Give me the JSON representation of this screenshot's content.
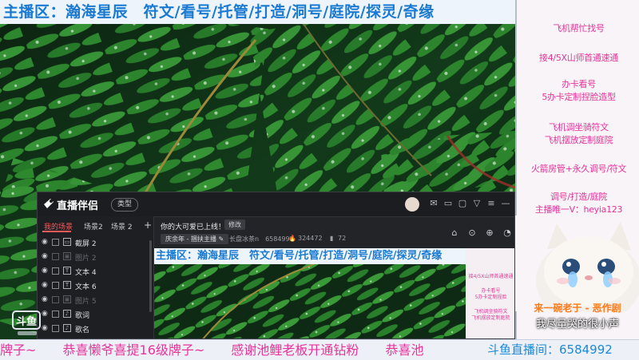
{
  "stream": {
    "top_banner": "主播区：瀚海星辰　符文/看号/托管/打造/洞号/庭院/探灵/奇缘",
    "right_panel": {
      "lines": [
        "飞机帮忙找号",
        "接4/5X山师首通速通",
        "办卡看号",
        "5办卡定制捏脸造型",
        "飞机调坐骑符文",
        "飞机摆放定制庭院",
        "火箭房管+永久调号/符文",
        "调号/打造/庭院",
        "主播唯一V：heyia123"
      ],
      "overlay_orange": "来一碗老于 - 恶作剧",
      "overlay_white": "我尽量哭的很小声"
    },
    "ticker": {
      "items": [
        "牌子~",
        "恭喜懒爷喜提16级牌子~",
        "感谢池鲤老板开通钻粉",
        "恭喜池"
      ],
      "live_label": "斗鱼直播间：6584992"
    },
    "platform_logo": "斗鱼"
  },
  "app": {
    "name": "直播伴侣",
    "badge": "类型",
    "scene_tabs": [
      "我的场景",
      "场景2",
      "场景 2"
    ],
    "scene_add": "+",
    "layers": [
      {
        "name": "截屏 2",
        "dim": false,
        "type": "▭"
      },
      {
        "name": "图片 2",
        "dim": true,
        "type": "▣"
      },
      {
        "name": "文本 4",
        "dim": false,
        "type": "T"
      },
      {
        "name": "文本 6",
        "dim": false,
        "type": "T"
      },
      {
        "name": "图片 5",
        "dim": true,
        "type": "▣"
      },
      {
        "name": "歌词",
        "dim": false,
        "type": "♪"
      },
      {
        "name": "歌名",
        "dim": false,
        "type": "♪"
      }
    ],
    "notice": "你的大可爱已上线！",
    "edit_label": "修改",
    "category": "庆余年 - 捆扶主播",
    "room_id": "长盘冰茶n　6584992",
    "hot": "324472",
    "fans": "72",
    "preview": {
      "banner": "主播区：瀚海星辰　符文/看号/托管/打造/洞号/庭院/探灵/奇缘",
      "right_lines": [
        "接4/5X山师首通速通",
        "办卡看号",
        "5办卡定制捏脸",
        "飞机调坐骑符文",
        "飞机摆放定制庭院"
      ]
    }
  },
  "colors": {
    "banner_text": "#1a7ad1",
    "panel_pink": "#e53399",
    "ticker_pink": "#e8329a",
    "accent_red": "#ff5a5a"
  }
}
